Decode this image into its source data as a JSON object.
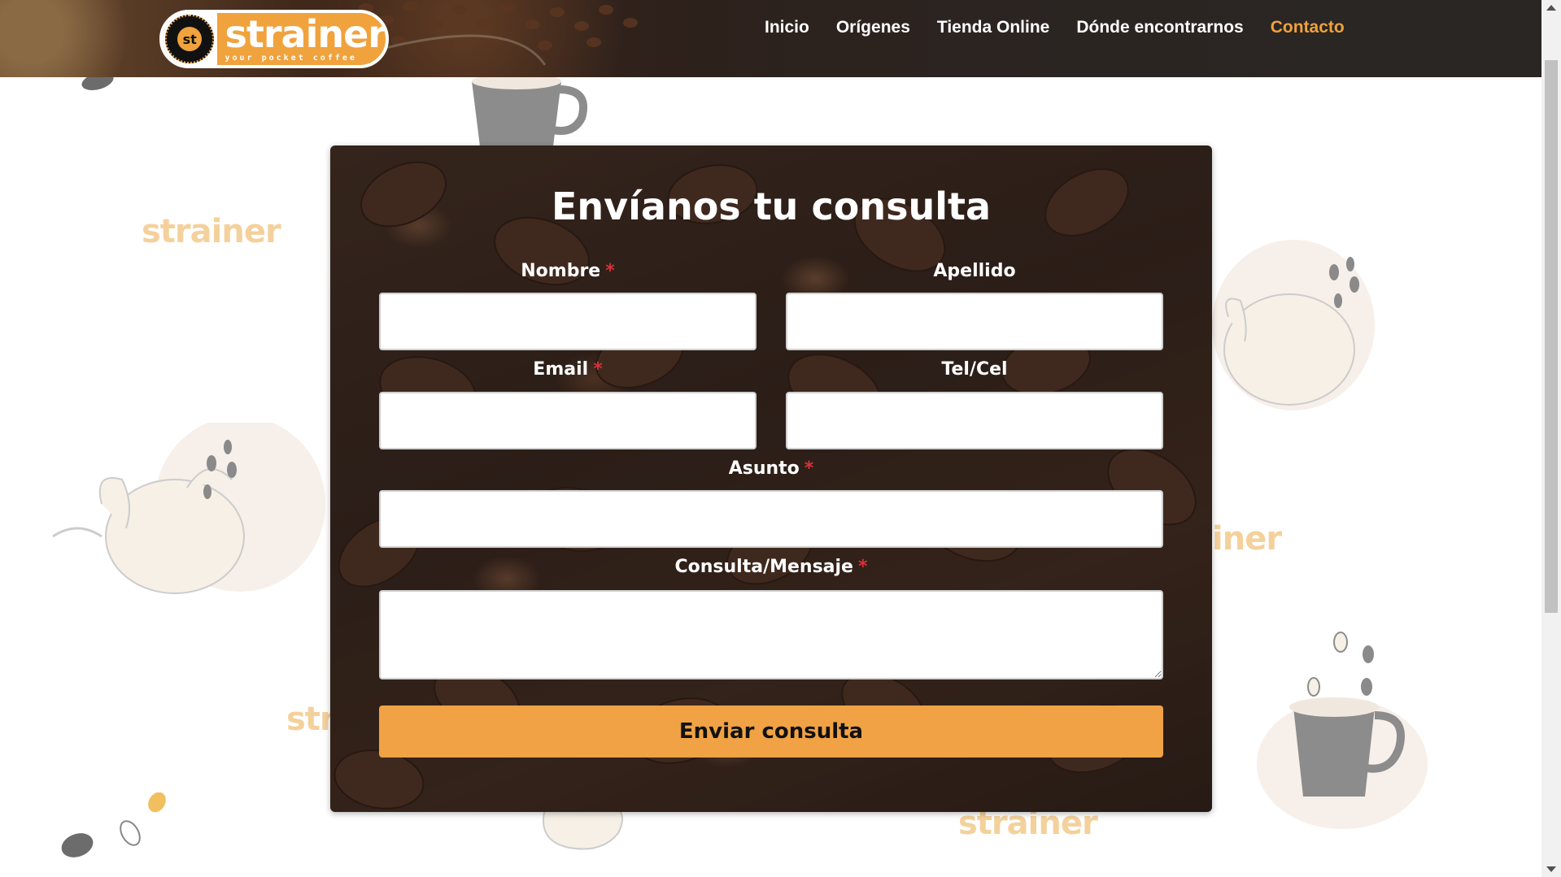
{
  "logo": {
    "badge": "st",
    "brand": "strainer",
    "tagline": "your pocket coffee"
  },
  "nav": {
    "items": [
      {
        "label": "Inicio"
      },
      {
        "label": "Orígenes"
      },
      {
        "label": "Tienda Online"
      },
      {
        "label": "Dónde encontrarnos"
      },
      {
        "label": "Contacto"
      }
    ],
    "active": "Contacto",
    "active_color": "#f0a23c"
  },
  "background": {
    "watermark": "strainer",
    "watermark_partial_1": "iner",
    "watermark_partial_2": "str",
    "curved_text": "your pocket coffee"
  },
  "form": {
    "title": "Envíanos tu consulta",
    "required_mark": "*",
    "fields": {
      "nombre": {
        "label": "Nombre",
        "value": "",
        "required": true
      },
      "apellido": {
        "label": "Apellido",
        "value": "",
        "required": false
      },
      "email": {
        "label": "Email",
        "value": "",
        "required": true
      },
      "telcel": {
        "label": "Tel/Cel",
        "value": "",
        "required": false
      },
      "asunto": {
        "label": "Asunto",
        "value": "",
        "required": true
      },
      "mensaje": {
        "label": "Consulta/Mensaje",
        "value": "",
        "required": true
      }
    },
    "submit_label": "Enviar consulta",
    "accent_color": "#f0a245",
    "required_color": "#d8323a"
  }
}
